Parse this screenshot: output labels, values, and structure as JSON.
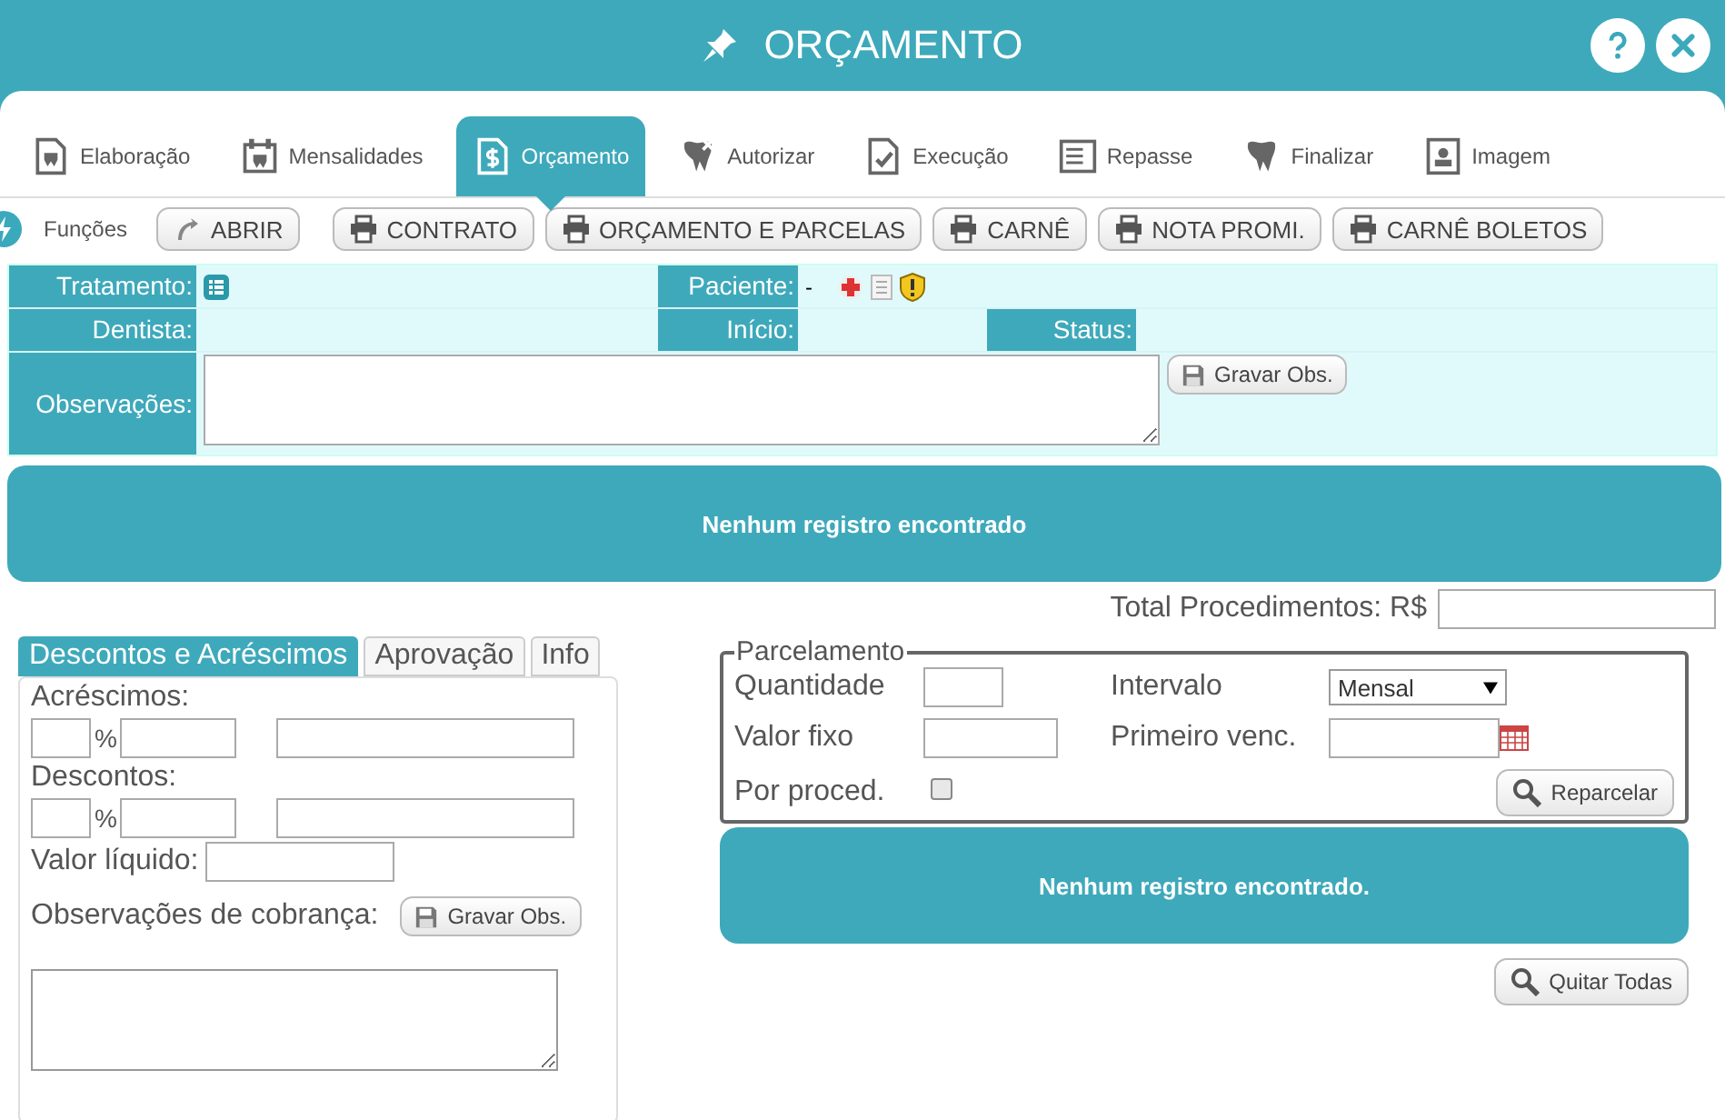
{
  "window": {
    "title": "ORÇAMENTO"
  },
  "tabs": [
    {
      "label": "Elaboração",
      "selected": false
    },
    {
      "label": "Mensalidades",
      "selected": false
    },
    {
      "label": "Orçamento",
      "selected": true
    },
    {
      "label": "Autorizar",
      "selected": false
    },
    {
      "label": "Execução",
      "selected": false
    },
    {
      "label": "Repasse",
      "selected": false
    },
    {
      "label": "Finalizar",
      "selected": false
    },
    {
      "label": "Imagem",
      "selected": false
    }
  ],
  "functions": {
    "label": "Funções",
    "buttons": [
      {
        "label": "ABRIR",
        "kind": "open"
      },
      {
        "label": "CONTRATO",
        "kind": "print"
      },
      {
        "label": "ORÇAMENTO E PARCELAS",
        "kind": "print"
      },
      {
        "label": "CARNÊ",
        "kind": "print"
      },
      {
        "label": "NOTA PROMI.",
        "kind": "print"
      },
      {
        "label": "CARNÊ BOLETOS",
        "kind": "print"
      }
    ]
  },
  "info": {
    "tratamento_label": "Tratamento:",
    "paciente_label": "Paciente:",
    "paciente_value": "-",
    "dentista_label": "Dentista:",
    "inicio_label": "Início:",
    "status_label": "Status:",
    "observacoes_label": "Observações:",
    "save_button": "Gravar Obs."
  },
  "procedures_message": "Nenhum registro encontrado",
  "total": {
    "label": "Total Procedimentos: R$"
  },
  "adjust_tabs": [
    {
      "label": "Descontos e Acréscimos",
      "selected": true
    },
    {
      "label": "Aprovação",
      "selected": false
    },
    {
      "label": "Info",
      "selected": false
    }
  ],
  "adjustments": {
    "acrescimos_label": "Acréscimos:",
    "acrescimos_percent": "%",
    "descontos_label": "Descontos:",
    "descontos_percent": "%",
    "valor_liquido_label": "Valor líquido:",
    "obs_label": "Observações de cobrança:",
    "save_button": "Gravar Obs."
  },
  "parcelamento": {
    "legend": "Parcelamento",
    "quantidade_label": "Quantidade",
    "intervalo_label": "Intervalo",
    "intervalo_value": "Mensal",
    "valor_fixo_label": "Valor fixo",
    "primeiro_venc_label": "Primeiro venc.",
    "por_proced_label": "Por proced.",
    "por_proced_checked": false,
    "reparcelar_button": "Reparcelar"
  },
  "installments_message": "Nenhum registro encontrado.",
  "quitar_button": "Quitar Todas"
}
